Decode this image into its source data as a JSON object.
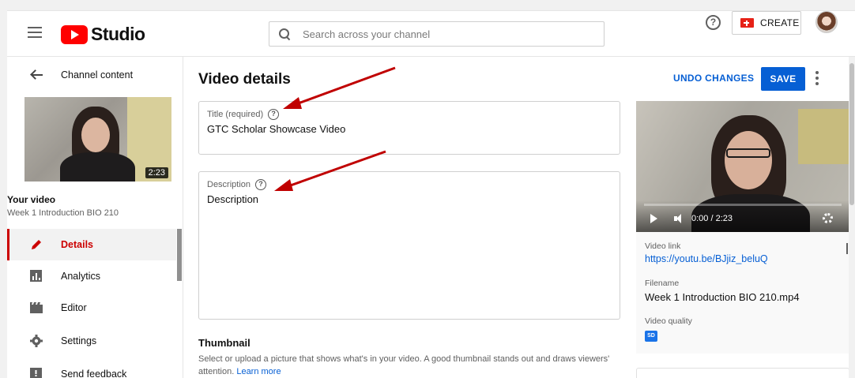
{
  "header": {
    "logo_text": "Studio",
    "search_placeholder": "Search across your channel",
    "create_label": "CREATE",
    "help_glyph": "?"
  },
  "sidebar": {
    "back_label": "Channel content",
    "thumbnail_duration": "2:23",
    "your_video_label": "Your video",
    "video_subtitle": "Week 1 Introduction BIO 210",
    "nav_items": [
      {
        "label": "Details",
        "icon": "pencil-icon",
        "active": true
      },
      {
        "label": "Analytics",
        "icon": "analytics-icon",
        "active": false
      },
      {
        "label": "Editor",
        "icon": "editor-icon",
        "active": false
      },
      {
        "label": "Settings",
        "icon": "gear-icon",
        "active": false
      },
      {
        "label": "Send feedback",
        "icon": "feedback-icon",
        "active": false
      }
    ]
  },
  "main": {
    "title": "Video details",
    "undo_label": "UNDO CHANGES",
    "save_label": "SAVE",
    "title_field": {
      "label": "Title (required)",
      "value": "GTC Scholar Showcase Video"
    },
    "description_field": {
      "label": "Description",
      "value": "Description"
    },
    "thumbnail": {
      "heading": "Thumbnail",
      "text": "Select or upload a picture that shows what's in your video. A good thumbnail stands out and draws viewers' attention.",
      "link": "Learn more"
    }
  },
  "preview": {
    "time": "0:00 / 2:23",
    "video_link_label": "Video link",
    "video_link": "https://youtu.be/BJjiz_beluQ",
    "filename_label": "Filename",
    "filename": "Week 1 Introduction BIO 210.mp4",
    "quality_label": "Video quality",
    "quality_badge": "SD"
  },
  "colors": {
    "brand_red": "#ff0000",
    "accent_blue": "#065fd4",
    "active_nav_red": "#cc0000",
    "annotation_red": "#c00000"
  }
}
